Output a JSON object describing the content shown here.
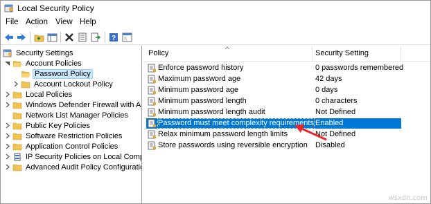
{
  "window": {
    "title": "Local Security Policy"
  },
  "menu": [
    "File",
    "Action",
    "View",
    "Help"
  ],
  "toolbar": {
    "buttons": [
      "back-arrow-icon",
      "forward-arrow-icon",
      "up-folder-icon",
      "show-hide-tree-icon",
      "delete-icon",
      "properties-icon",
      "export-list-icon",
      "help-icon",
      "console-icon"
    ]
  },
  "tree": [
    {
      "label": "Security Settings",
      "level": 0,
      "expanded": true,
      "icon": "security-settings-icon"
    },
    {
      "label": "Account Policies",
      "level": 1,
      "expanded": true,
      "icon": "folder-open-icon"
    },
    {
      "label": "Password Policy",
      "level": 2,
      "selected": true,
      "icon": "folder-open-icon"
    },
    {
      "label": "Account Lockout Policy",
      "level": 2,
      "collapsed": true,
      "icon": "folder-icon"
    },
    {
      "label": "Local Policies",
      "level": 1,
      "collapsed": true,
      "icon": "folder-icon"
    },
    {
      "label": "Windows Defender Firewall with Adva",
      "level": 1,
      "collapsed": true,
      "icon": "folder-icon"
    },
    {
      "label": "Network List Manager Policies",
      "level": 1,
      "icon": "folder-icon"
    },
    {
      "label": "Public Key Policies",
      "level": 1,
      "collapsed": true,
      "icon": "folder-icon"
    },
    {
      "label": "Software Restriction Policies",
      "level": 1,
      "collapsed": true,
      "icon": "folder-icon"
    },
    {
      "label": "Application Control Policies",
      "level": 1,
      "collapsed": true,
      "icon": "folder-icon"
    },
    {
      "label": "IP Security Policies on Local Compute",
      "level": 1,
      "collapsed": true,
      "icon": "ip-security-icon"
    },
    {
      "label": "Advanced Audit Policy Configuration",
      "level": 1,
      "collapsed": true,
      "icon": "folder-icon"
    }
  ],
  "list": {
    "columns": [
      "Policy",
      "Security Setting"
    ],
    "rows": [
      {
        "policy": "Enforce password history",
        "setting": "0 passwords remembered"
      },
      {
        "policy": "Maximum password age",
        "setting": "42 days"
      },
      {
        "policy": "Minimum password age",
        "setting": "0 days"
      },
      {
        "policy": "Minimum password length",
        "setting": "0 characters"
      },
      {
        "policy": "Minimum password length audit",
        "setting": "Not Defined"
      },
      {
        "policy": "Password must meet complexity requirements",
        "setting": "Enabled",
        "selected": true
      },
      {
        "policy": "Relax minimum password length limits",
        "setting": "Not Defined"
      },
      {
        "policy": "Store passwords using reversible encryption",
        "setting": "Disabled"
      }
    ]
  },
  "watermark": "wsxdn.com",
  "colors": {
    "selection": "#0078d7",
    "tree_selection": "#cce8ff",
    "arrow": "#e8262b",
    "folder": "#f0c454"
  }
}
